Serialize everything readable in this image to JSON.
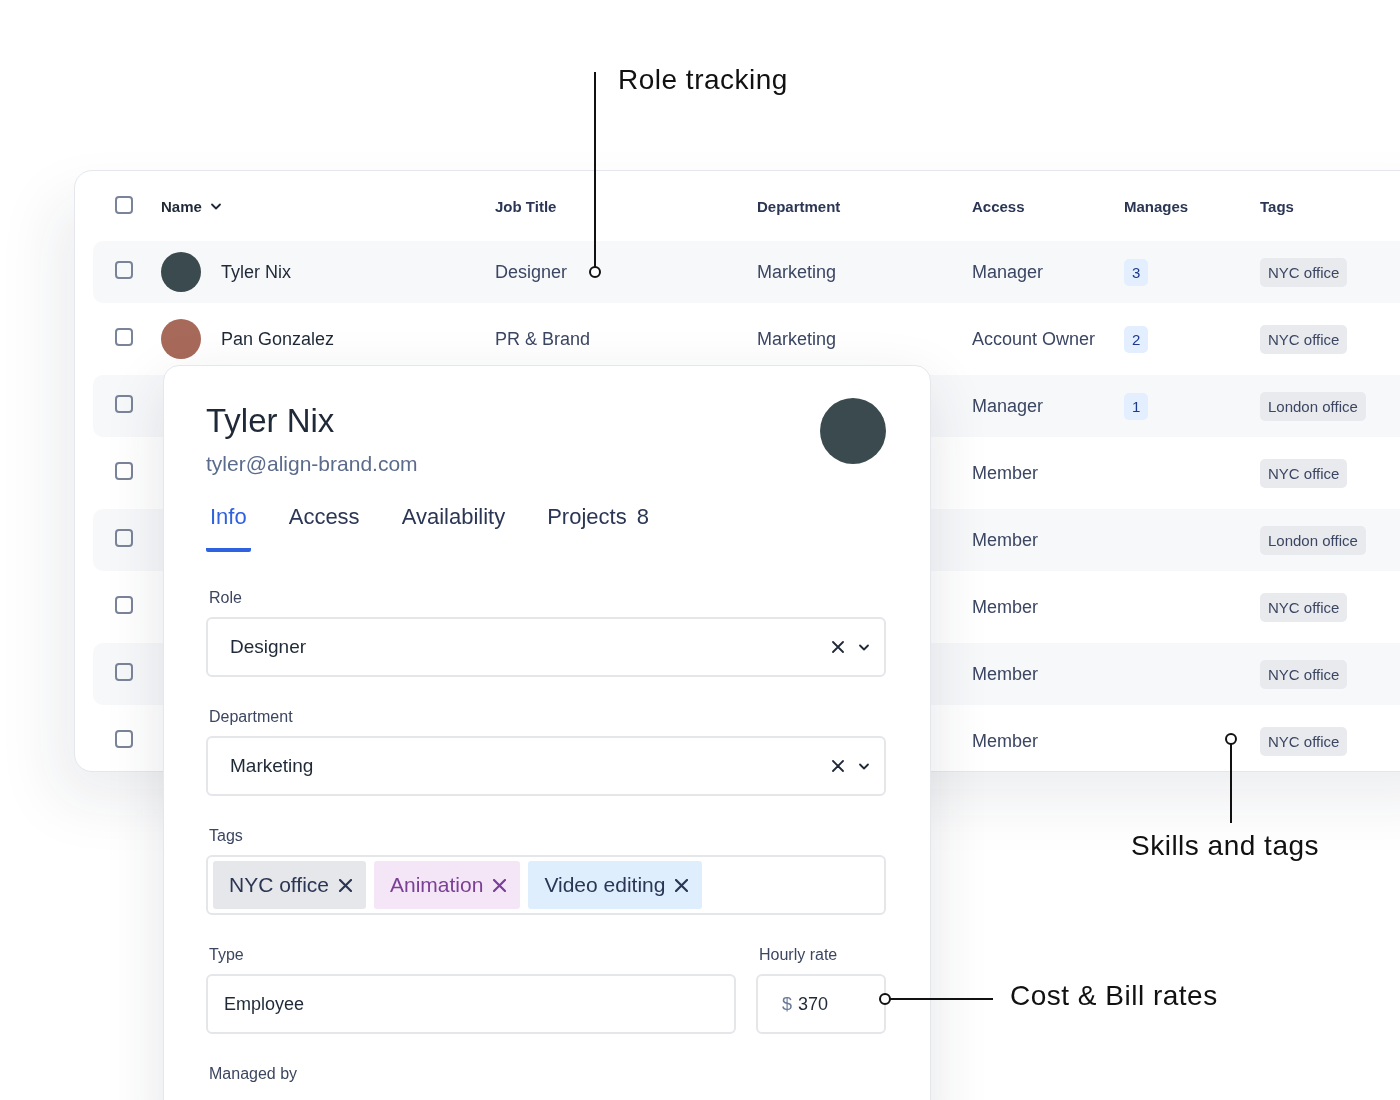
{
  "table": {
    "header_checkbox": {
      "checked": false
    },
    "columns": [
      "Name",
      "Job Title",
      "Department",
      "Access",
      "Manages",
      "Tags"
    ],
    "rows": [
      {
        "checked": false,
        "name": "Tyler Nix",
        "job_title": "Designer",
        "department": "Marketing",
        "access": "Manager",
        "manages": "3",
        "tags": [
          "NYC office"
        ]
      },
      {
        "checked": false,
        "name": "Pan Gonzalez",
        "job_title": "PR & Brand",
        "department": "Marketing",
        "access": "Account Owner",
        "manages": "2",
        "tags": [
          "NYC office"
        ]
      },
      {
        "checked": false,
        "access": "Manager",
        "manages": "1",
        "tags": [
          "London office"
        ]
      },
      {
        "checked": false,
        "access": "Member",
        "tags": [
          "NYC office"
        ]
      },
      {
        "checked": false,
        "access": "Member",
        "tags": [
          "London office"
        ]
      },
      {
        "checked": false,
        "access": "Member",
        "tags": [
          "NYC office"
        ]
      },
      {
        "checked": false,
        "access": "Member",
        "tags": [
          "NYC office"
        ]
      },
      {
        "checked": false,
        "access": "Member",
        "tags": [
          "NYC office"
        ]
      }
    ]
  },
  "profile": {
    "name": "Tyler Nix",
    "email": "tyler@align-brand.com",
    "tabs": [
      {
        "label": "Info",
        "selected": true
      },
      {
        "label": "Access",
        "selected": false
      },
      {
        "label": "Availability",
        "selected": false
      },
      {
        "label": "Projects",
        "count": "8",
        "selected": false
      }
    ],
    "role": {
      "label": "Role",
      "value": "Designer"
    },
    "department": {
      "label": "Department",
      "value": "Marketing"
    },
    "tags": {
      "label": "Tags",
      "items": [
        {
          "label": "NYC office",
          "color": "#e6e7ea"
        },
        {
          "label": "Animation",
          "color": "#f4e6f7"
        },
        {
          "label": "Video editing",
          "color": "#dfeefd"
        }
      ]
    },
    "type": {
      "label": "Type",
      "value": "Employee"
    },
    "hourly_rate": {
      "label": "Hourly rate",
      "prefix": "$",
      "value": "370"
    },
    "managed_by": {
      "label": "Managed by"
    }
  },
  "callouts": [
    {
      "label": "Role tracking"
    },
    {
      "label": "Skills and tags"
    },
    {
      "label": "Cost & Bill rates"
    }
  ]
}
